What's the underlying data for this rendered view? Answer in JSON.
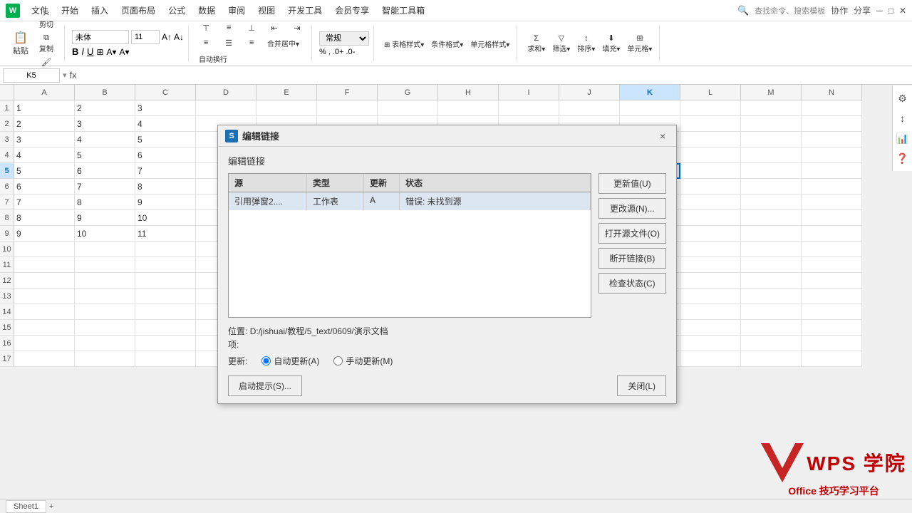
{
  "titleBar": {
    "menuItems": [
      "文件",
      "开始",
      "插入",
      "页面布局",
      "公式",
      "数据",
      "审阅",
      "视图",
      "开发工具",
      "会员专享",
      "智能工具箱"
    ],
    "openBtn": "开始",
    "search": "查找命令、搜索模板",
    "undoIcon": "↺",
    "redoIcon": "↻",
    "shareBtn": "分享",
    "cooperateBtn": "协作"
  },
  "ribbon": {
    "pasteGroup": {
      "pasteLabel": "粘贴",
      "cutLabel": "剪切",
      "copyLabel": "复制",
      "formatLabel": "格式刷"
    },
    "fontGroup": {
      "fontName": "未体",
      "fontSize": "11",
      "boldLabel": "B",
      "italicLabel": "I",
      "underlineLabel": "U",
      "borderLabel": "⊞",
      "highlightLabel": "A",
      "colorLabel": "A"
    },
    "alignGroup": {
      "topLabel": "≡",
      "middleLabel": "≡",
      "bottomLabel": "≡",
      "leftLabel": "≡",
      "centerLabel": "≡",
      "rightLabel": "≡",
      "mergeLabel": "合并居中",
      "wrapLabel": "自动换行"
    },
    "formatGroup": {
      "label": "常规",
      "conditionalLabel": "条件格式",
      "tableStyleLabel": "表格样式",
      "cellStyleLabel": "单元格样式"
    },
    "calcGroup": {
      "sumLabel": "求和",
      "filterLabel": "筛选",
      "sortLabel": "排序",
      "fillLabel": "填充",
      "cellLabel": "单元格"
    }
  },
  "formulaBar": {
    "cellRef": "K5",
    "fxIcon": "fx",
    "formula": ""
  },
  "grid": {
    "columns": [
      "A",
      "B",
      "C",
      "D",
      "E",
      "F",
      "G",
      "H",
      "I",
      "J",
      "K",
      "L",
      "M",
      "N"
    ],
    "activeCol": "K",
    "activeRow": 5,
    "rows": [
      {
        "rowNum": 1,
        "cells": {
          "A": "1",
          "B": "2",
          "C": "3"
        }
      },
      {
        "rowNum": 2,
        "cells": {
          "A": "2",
          "B": "3",
          "C": "4"
        }
      },
      {
        "rowNum": 3,
        "cells": {
          "A": "3",
          "B": "4",
          "C": "5"
        }
      },
      {
        "rowNum": 4,
        "cells": {
          "A": "4",
          "B": "5",
          "C": "6"
        }
      },
      {
        "rowNum": 5,
        "cells": {
          "A": "5",
          "B": "6",
          "C": "7"
        }
      },
      {
        "rowNum": 6,
        "cells": {
          "A": "6",
          "B": "7",
          "C": "8"
        }
      },
      {
        "rowNum": 7,
        "cells": {
          "A": "7",
          "B": "8",
          "C": "9"
        }
      },
      {
        "rowNum": 8,
        "cells": {
          "A": "8",
          "B": "9",
          "C": "10"
        }
      },
      {
        "rowNum": 9,
        "cells": {
          "A": "9",
          "B": "10",
          "C": "11"
        }
      },
      {
        "rowNum": 10,
        "cells": {}
      },
      {
        "rowNum": 11,
        "cells": {}
      },
      {
        "rowNum": 12,
        "cells": {}
      },
      {
        "rowNum": 13,
        "cells": {}
      },
      {
        "rowNum": 14,
        "cells": {}
      },
      {
        "rowNum": 15,
        "cells": {}
      },
      {
        "rowNum": 16,
        "cells": {}
      },
      {
        "rowNum": 17,
        "cells": {}
      }
    ]
  },
  "dialog": {
    "titleIcon": "S",
    "titleText": "编辑链接",
    "closeBtn": "×",
    "sectionTitle": "编辑链接",
    "tableHeaders": [
      "源",
      "类型",
      "更新",
      "状态"
    ],
    "tableRows": [
      {
        "source": "引用弹窗2....",
        "type": "工作表",
        "update": "A",
        "status": "错误: 未找到源"
      }
    ],
    "buttons": [
      "更新值(U)",
      "更改源(N)...",
      "打开源文件(O)",
      "断开链接(B)",
      "检查状态(C)"
    ],
    "positionLabel": "位置:",
    "positionValue": "D:/jishuai/教程/5_text/0609/演示文档",
    "itemsLabel": "项:",
    "updateLabel": "更新:",
    "autoUpdateLabel": "自动更新(A)",
    "manualUpdateLabel": "手动更新(M)",
    "startupHintBtn": "启动提示(S)...",
    "closeDialogBtn": "关闭(L)"
  },
  "wpsLogo": {
    "brandText": "WPS 学院",
    "subText": "Office 技巧学习平台"
  },
  "statusBar": {
    "sheetTabs": [
      "Sheet1"
    ]
  }
}
